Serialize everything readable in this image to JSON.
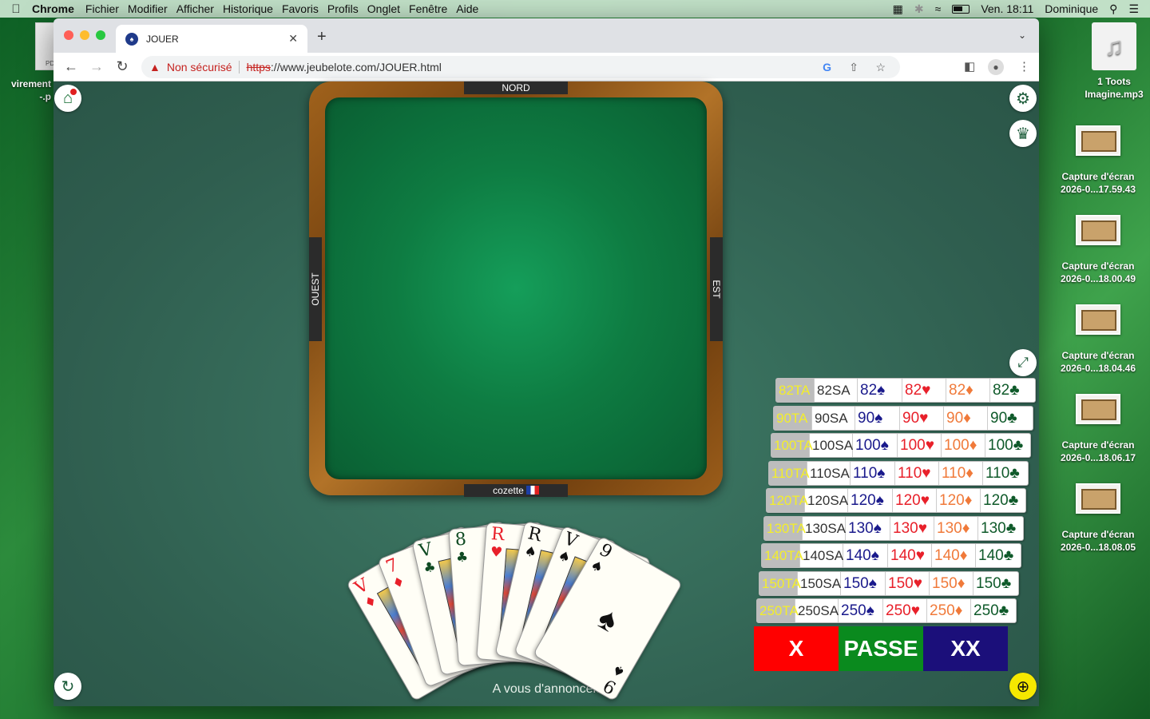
{
  "menubar": {
    "app": "Chrome",
    "items": [
      "Fichier",
      "Modifier",
      "Afficher",
      "Historique",
      "Favoris",
      "Profils",
      "Onglet",
      "Fenêtre",
      "Aide"
    ],
    "clock": "Ven. 18:11",
    "user": "Dominique"
  },
  "desktop": {
    "left_label1": "virement",
    "left_label2": "-.p",
    "pdf_label": "PD",
    "icons": [
      {
        "line1": "1 Toots",
        "line2": "Imagine.mp3"
      },
      {
        "line1": "Capture d'écran",
        "line2": "2026-0...17.59.43"
      },
      {
        "line1": "Capture d'écran",
        "line2": "2026-0...18.00.49"
      },
      {
        "line1": "Capture d'écran",
        "line2": "2026-0...18.04.46"
      },
      {
        "line1": "Capture d'écran",
        "line2": "2026-0...18.06.17"
      },
      {
        "line1": "Capture d'écran",
        "line2": "2026-0...18.08.05"
      }
    ]
  },
  "browser": {
    "tab_title": "JOUER",
    "security_label": "Non sécurisé",
    "url_scheme": "https",
    "url_rest": "://www.jeubelote.com/JOUER.html"
  },
  "game": {
    "seats": {
      "north": "NORD",
      "west": "OUEST",
      "east": "EST",
      "south": "cozette"
    },
    "status": "A vous d'annoncer.",
    "hand": [
      {
        "rank": "V",
        "suit": "♦",
        "color": "red",
        "face": true
      },
      {
        "rank": "7",
        "suit": "♦",
        "color": "red",
        "face": false
      },
      {
        "rank": "V",
        "suit": "♣",
        "color": "grn",
        "face": true
      },
      {
        "rank": "8",
        "suit": "♣",
        "color": "grn",
        "face": false
      },
      {
        "rank": "R",
        "suit": "♥",
        "color": "red",
        "face": true
      },
      {
        "rank": "R",
        "suit": "♠",
        "color": "blk",
        "face": true
      },
      {
        "rank": "V",
        "suit": "♠",
        "color": "blk",
        "face": true
      },
      {
        "rank": "9",
        "suit": "♠",
        "color": "blk",
        "face": false
      }
    ],
    "bids": [
      {
        "ta": "82TA",
        "sa": "82SA",
        "pi": "82♠",
        "co": "82♥",
        "ca": "82♦",
        "tr": "82♣"
      },
      {
        "ta": "90TA",
        "sa": "90SA",
        "pi": "90♠",
        "co": "90♥",
        "ca": "90♦",
        "tr": "90♣"
      },
      {
        "ta": "100TA",
        "sa": "100SA",
        "pi": "100♠",
        "co": "100♥",
        "ca": "100♦",
        "tr": "100♣"
      },
      {
        "ta": "110TA",
        "sa": "110SA",
        "pi": "110♠",
        "co": "110♥",
        "ca": "110♦",
        "tr": "110♣"
      },
      {
        "ta": "120TA",
        "sa": "120SA",
        "pi": "120♠",
        "co": "120♥",
        "ca": "120♦",
        "tr": "120♣"
      },
      {
        "ta": "130TA",
        "sa": "130SA",
        "pi": "130♠",
        "co": "130♥",
        "ca": "130♦",
        "tr": "130♣"
      },
      {
        "ta": "140TA",
        "sa": "140SA",
        "pi": "140♠",
        "co": "140♥",
        "ca": "140♦",
        "tr": "140♣"
      },
      {
        "ta": "150TA",
        "sa": "150SA",
        "pi": "150♠",
        "co": "150♥",
        "ca": "150♦",
        "tr": "150♣"
      },
      {
        "ta": "250TA",
        "sa": "250SA",
        "pi": "250♠",
        "co": "250♥",
        "ca": "250♦",
        "tr": "250♣"
      }
    ],
    "actions": [
      {
        "label": "X",
        "color": "#ff0000"
      },
      {
        "label": "PASSE",
        "color": "#0a8a1e"
      },
      {
        "label": "XX",
        "color": "#1b0f7a"
      }
    ]
  }
}
